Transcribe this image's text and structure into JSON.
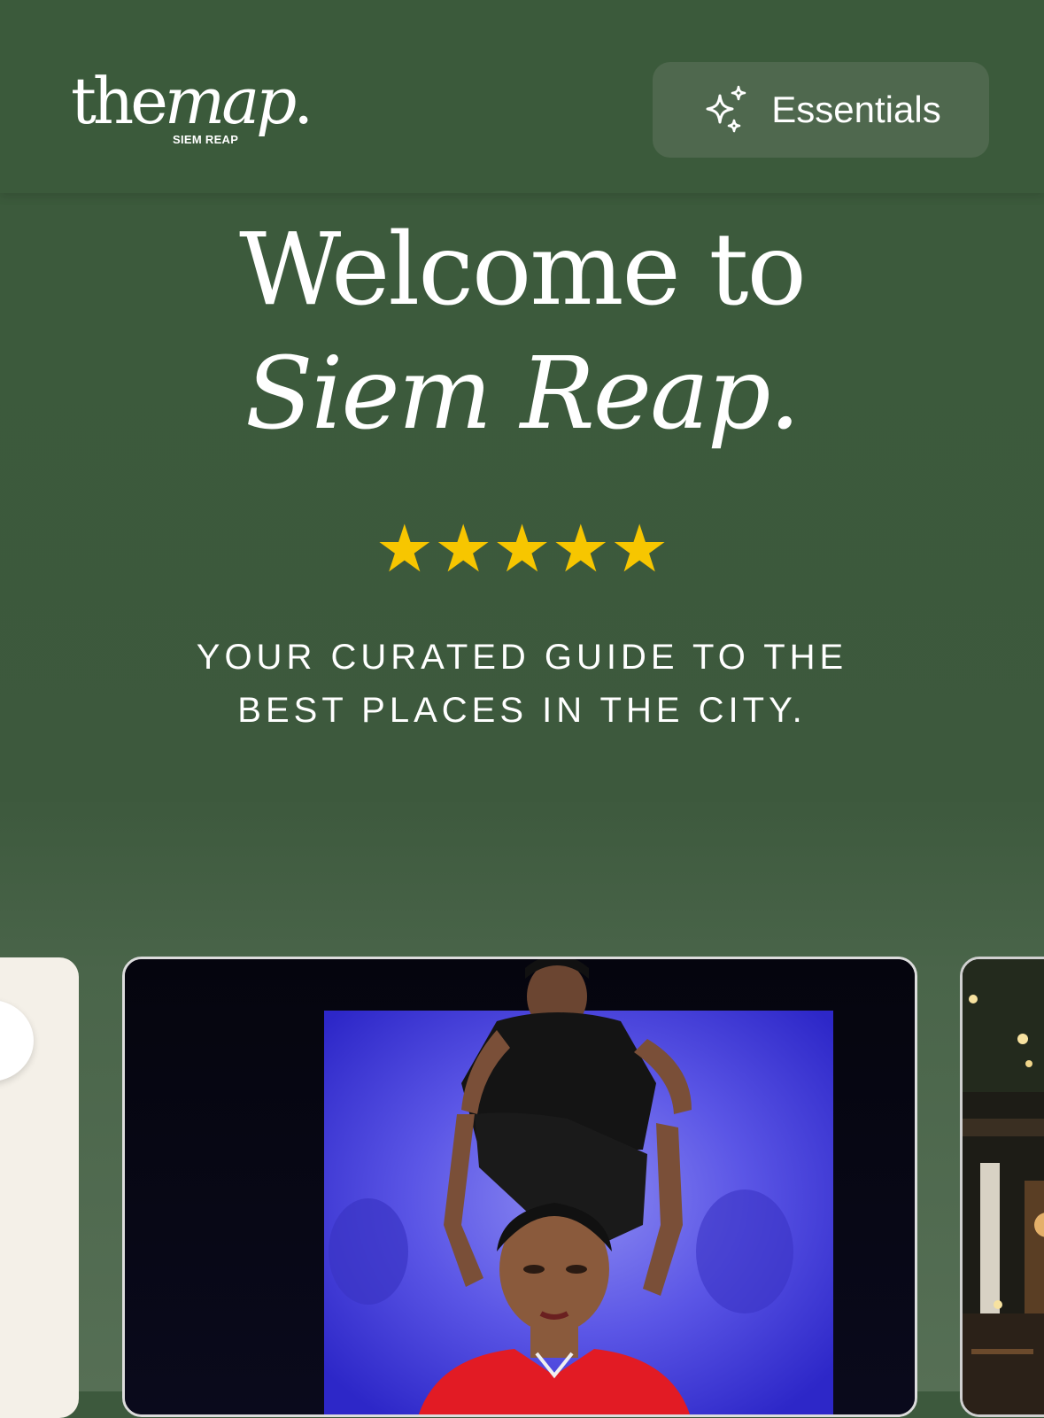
{
  "header": {
    "logo": {
      "word_regular": "the",
      "word_italic": "map",
      "dot": ".",
      "subtitle": "SIEM REAP"
    },
    "essentials_button": {
      "label": "Essentials",
      "icon": "sparkles-icon"
    }
  },
  "hero": {
    "title_line1": "Welcome to",
    "title_line2": "Siem Reap.",
    "rating": {
      "stars": 5,
      "max": 5,
      "display": "★★★★★",
      "color": "#f7c600"
    },
    "tagline_line1": "YOUR CURATED GUIDE TO THE",
    "tagline_line2": "BEST PLACES IN THE CITY."
  },
  "carousel": {
    "cards": [
      {
        "id": "card-left",
        "image": "partial-cream-card"
      },
      {
        "id": "card-main",
        "image": "performer-photo-stage"
      },
      {
        "id": "card-right",
        "image": "restaurant-night-photo"
      }
    ]
  },
  "colors": {
    "brand_green": "#3b5a3b",
    "button_green": "#4f684e",
    "star_yellow": "#f7c600",
    "text_white": "#ffffff"
  }
}
